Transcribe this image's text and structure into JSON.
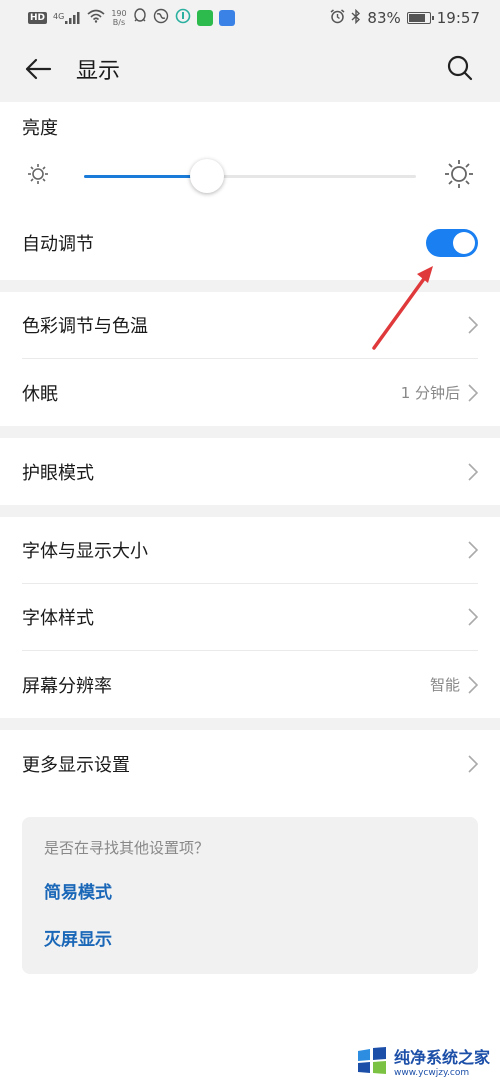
{
  "status_bar": {
    "hd": "HD",
    "network": "4G",
    "speed_value": "190",
    "speed_unit": "B/s",
    "battery_percent": "83%",
    "battery_level": 0.83,
    "time": "19:57",
    "app_colors": [
      "#2dbb4e",
      "#3b82e6"
    ]
  },
  "app_bar": {
    "title": "显示",
    "back_icon": "arrow-left-icon",
    "search_icon": "search-icon"
  },
  "brightness": {
    "label": "亮度",
    "value": 0.37,
    "accent": "#1a7bd9"
  },
  "auto_adjust": {
    "label": "自动调节",
    "enabled": true,
    "accent": "#1a7ff0"
  },
  "groups": [
    {
      "items": [
        {
          "label": "色彩调节与色温",
          "value": ""
        },
        {
          "label": "休眠",
          "value": "1 分钟后"
        }
      ]
    },
    {
      "items": [
        {
          "label": "护眼模式",
          "value": ""
        }
      ]
    },
    {
      "items": [
        {
          "label": "字体与显示大小",
          "value": ""
        },
        {
          "label": "字体样式",
          "value": ""
        },
        {
          "label": "屏幕分辨率",
          "value": "智能"
        }
      ]
    },
    {
      "items": [
        {
          "label": "更多显示设置",
          "value": ""
        }
      ]
    }
  ],
  "suggestions": {
    "title": "是否在寻找其他设置项？",
    "links": [
      "简易模式",
      "灭屏显示"
    ],
    "link_color": "#1a67b8"
  },
  "watermark": {
    "name": "纯净系统之家",
    "url": "www.ycwjzy.com"
  }
}
